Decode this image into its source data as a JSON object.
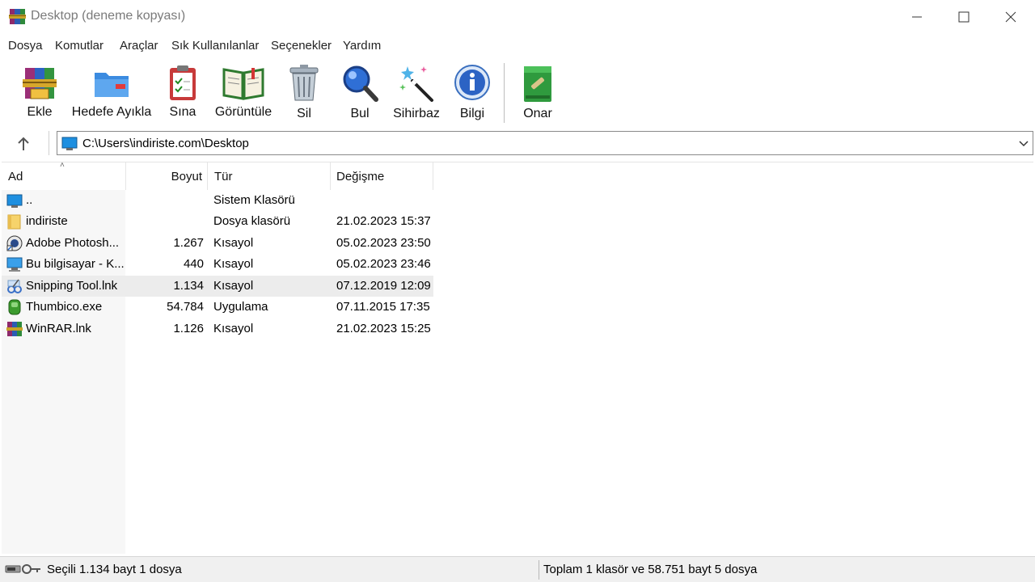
{
  "window": {
    "title": "Desktop (deneme kopyası)"
  },
  "menu": [
    "Dosya",
    "Komutlar",
    "Araçlar",
    "Sık Kullanılanlar",
    "Seçenekler",
    "Yardım"
  ],
  "toolbar": [
    {
      "label": "Ekle",
      "icon": "add-archive-icon"
    },
    {
      "label": "Hedefe Ayıkla",
      "icon": "extract-folder-icon"
    },
    {
      "label": "Sına",
      "icon": "test-clipboard-icon"
    },
    {
      "label": "Görüntüle",
      "icon": "view-book-icon"
    },
    {
      "label": "Sil",
      "icon": "trash-icon"
    },
    {
      "label": "Bul",
      "icon": "magnifier-icon"
    },
    {
      "label": "Sihirbaz",
      "icon": "wizard-wand-icon"
    },
    {
      "label": "Bilgi",
      "icon": "info-icon"
    },
    {
      "label": "Onar",
      "icon": "repair-icon"
    }
  ],
  "address": {
    "path": "C:\\Users\\indiriste.com\\Desktop"
  },
  "columns": {
    "name": "Ad",
    "size": "Boyut",
    "type": "Tür",
    "modified": "Değişme"
  },
  "files": [
    {
      "name": "..",
      "size": "",
      "type": "Sistem Klasörü",
      "date": "",
      "icon": "parent-folder-icon"
    },
    {
      "name": "indiriste",
      "size": "",
      "type": "Dosya klasörü",
      "date": "21.02.2023 15:37",
      "icon": "folder-icon"
    },
    {
      "name": "Adobe Photosh...",
      "size": "1.267",
      "type": "Kısayol",
      "date": "05.02.2023 23:50",
      "icon": "photoshop-shortcut-icon"
    },
    {
      "name": "Bu bilgisayar - K...",
      "size": "440",
      "type": "Kısayol",
      "date": "05.02.2023 23:46",
      "icon": "computer-shortcut-icon"
    },
    {
      "name": "Snipping Tool.lnk",
      "size": "1.134",
      "type": "Kısayol",
      "date": "07.12.2019 12:09",
      "icon": "snipping-tool-icon",
      "selected": true
    },
    {
      "name": "Thumbico.exe",
      "size": "54.784",
      "type": "Uygulama",
      "date": "07.11.2015 17:35",
      "icon": "thumbico-app-icon"
    },
    {
      "name": "WinRAR.lnk",
      "size": "1.126",
      "type": "Kısayol",
      "date": "21.02.2023 15:25",
      "icon": "winrar-shortcut-icon"
    }
  ],
  "status": {
    "left": "Seçili 1.134 bayt 1 dosya",
    "right": "Toplam 1 klasör ve 58.751 bayt 5 dosya"
  }
}
